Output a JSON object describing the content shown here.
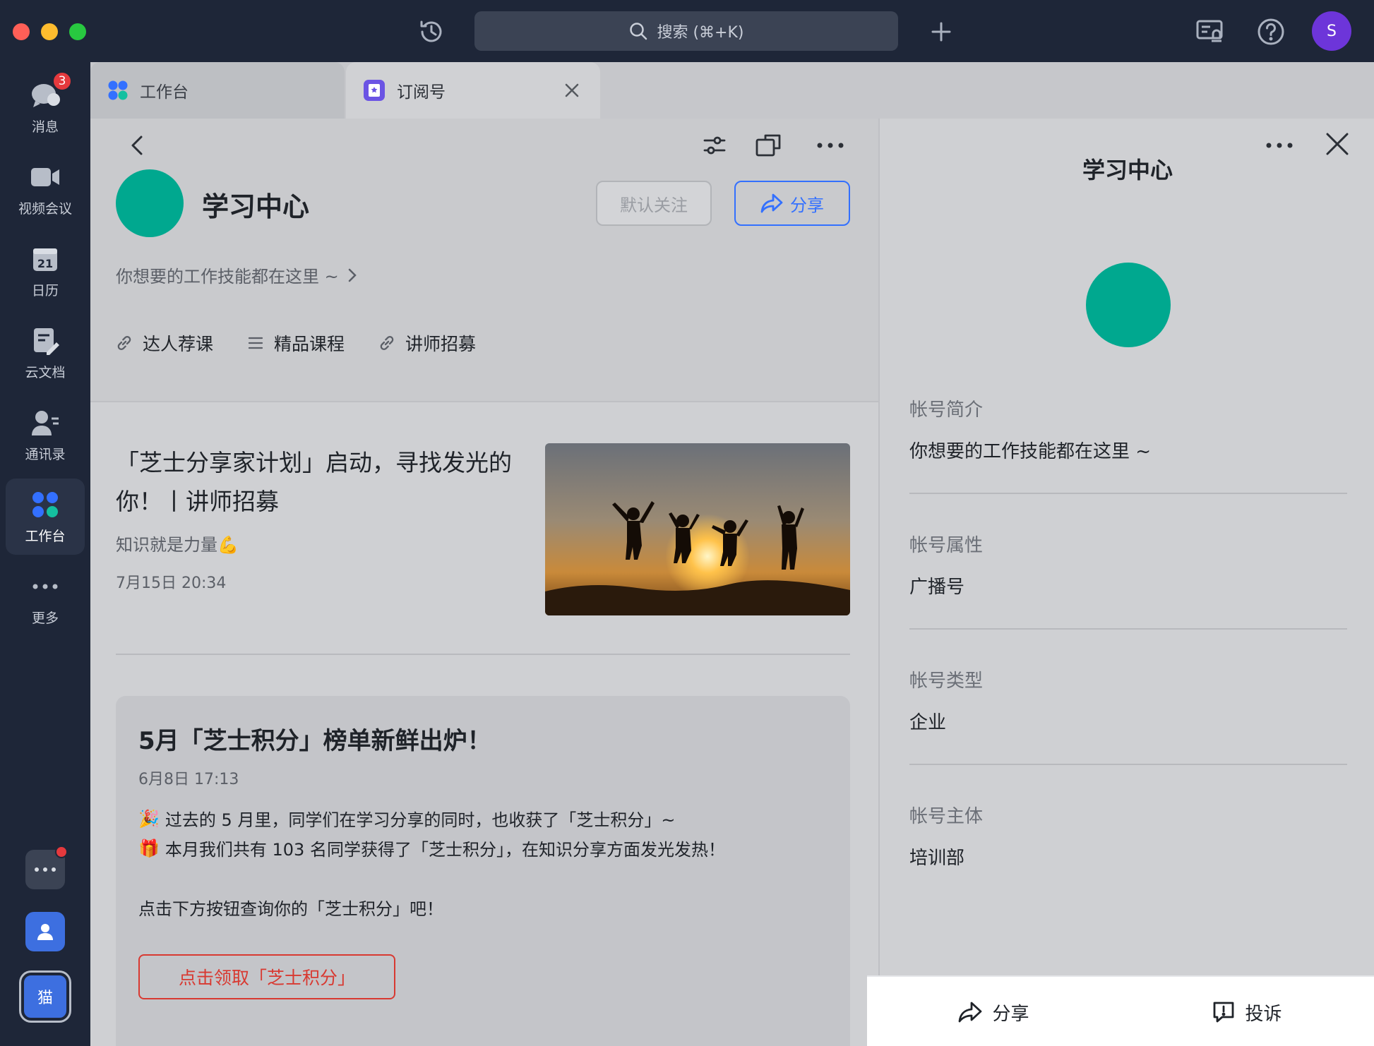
{
  "titlebar": {
    "search_placeholder": "搜索 (⌘+K)",
    "avatar_letter": "S"
  },
  "rail": {
    "items": [
      {
        "label": "消息",
        "badge": "3"
      },
      {
        "label": "视频会议"
      },
      {
        "label": "日历",
        "calendar_day": "21"
      },
      {
        "label": "云文档"
      },
      {
        "label": "通讯录"
      },
      {
        "label": "工作台"
      },
      {
        "label": "更多"
      }
    ],
    "bottom_app_label": "猫"
  },
  "tabs": [
    {
      "label": "工作台"
    },
    {
      "label": "订阅号"
    }
  ],
  "account": {
    "name": "学习中心",
    "follow_label": "默认关注",
    "share_label": "分享",
    "description": "你想要的工作技能都在这里 ~",
    "menu": [
      {
        "label": "达人荐课",
        "icon": "link-icon"
      },
      {
        "label": "精品课程",
        "icon": "list-icon"
      },
      {
        "label": "讲师招募",
        "icon": "link-icon"
      }
    ]
  },
  "posts": [
    {
      "title": "「芝士分享家计划」启动，寻找发光的你！丨讲师招募",
      "subtitle": "知识就是力量💪",
      "date": "7月15日 20:34"
    }
  ],
  "card": {
    "title": "5月「芝士积分」榜单新鲜出炉！",
    "date": "6月8日 17:13",
    "line1_emoji": "🎉",
    "line1": "过去的 5 月里，同学们在学习分享的同时，也收获了「芝士积分」~",
    "line2_emoji": "🎁",
    "line2": "本月我们共有 103 名同学获得了「芝士积分」，在知识分享方面发光发热！",
    "line3": "点击下方按钮查询你的「芝士积分」吧！",
    "button_label": "点击领取「芝士积分」"
  },
  "profile": {
    "title": "学习中心",
    "fields": [
      {
        "label": "帐号简介",
        "value": "你想要的工作技能都在这里 ~"
      },
      {
        "label": "帐号属性",
        "value": "广播号"
      },
      {
        "label": "帐号类型",
        "value": "企业"
      },
      {
        "label": "帐号主体",
        "value": "培训部"
      }
    ],
    "share_label": "分享",
    "report_label": "投诉"
  },
  "colors": {
    "accent": "#3370ff",
    "danger": "#d83931",
    "account_avatar": "#00a88f",
    "user_avatar": "#6d35d9"
  }
}
